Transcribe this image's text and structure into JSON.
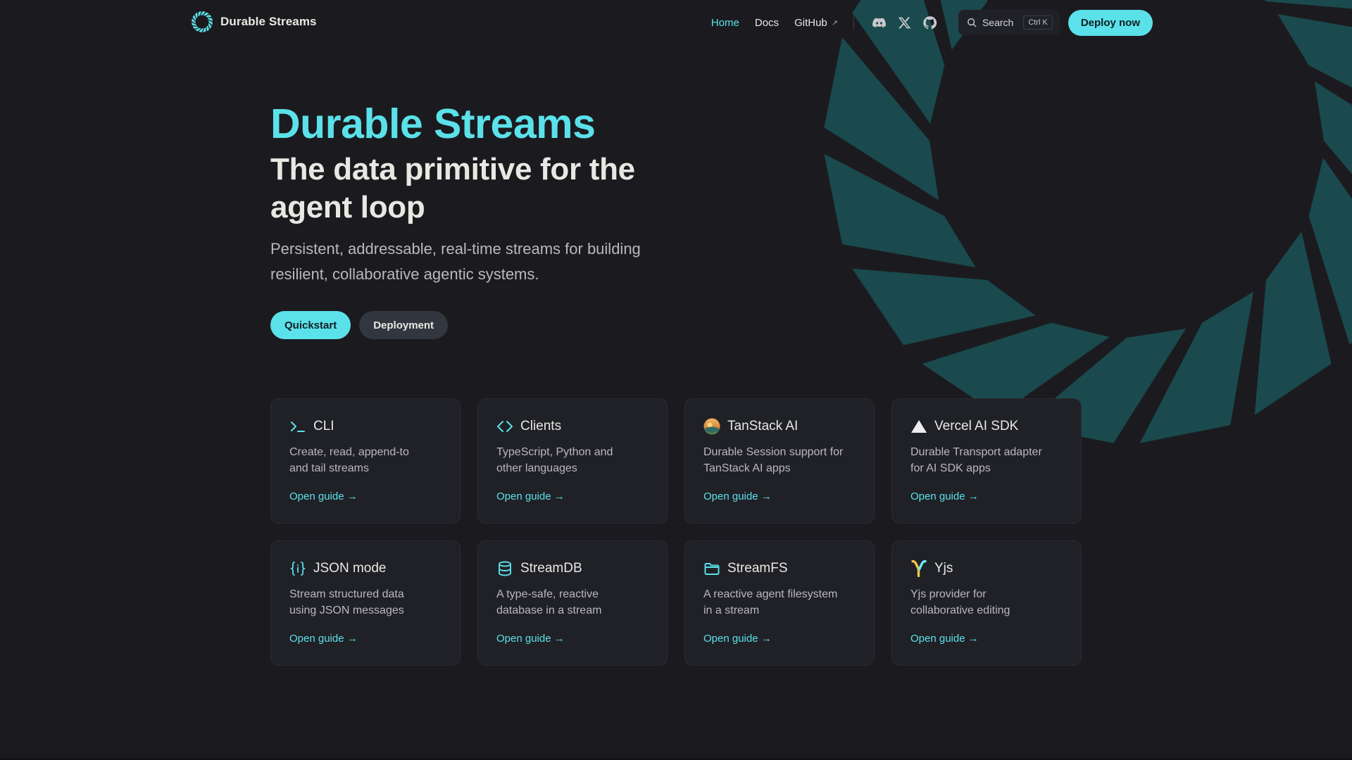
{
  "colors": {
    "accent": "#5be1ea",
    "background": "#1b1b1f",
    "card": "#202127",
    "logo_bg": "#1a4a4d"
  },
  "brand": {
    "name": "Durable Streams",
    "logo_icon": "durable-streams-logo"
  },
  "nav": {
    "links": [
      {
        "label": "Home",
        "active": true
      },
      {
        "label": "Docs",
        "active": false
      },
      {
        "label": "GitHub",
        "external": true
      }
    ],
    "external_arrow": "↗",
    "social": [
      "discord-icon",
      "x-icon",
      "github-icon"
    ],
    "search": {
      "label": "Search",
      "shortcut": "Ctrl K"
    },
    "deploy_label": "Deploy now"
  },
  "hero": {
    "title": "Durable Streams",
    "tagline": "The data primitive for the agent loop",
    "text": "Persistent, addressable, real-time streams for building resilient, collaborative agentic systems.",
    "primary_action": "Quickstart",
    "secondary_action": "Deployment"
  },
  "features": [
    {
      "title": "CLI",
      "desc": "Create, read, append-to and tail streams",
      "link": "Open guide →",
      "icon": "terminal-icon"
    },
    {
      "title": "Clients",
      "desc": "TypeScript, Python and other languages",
      "link": "Open guide →",
      "icon": "code-icon"
    },
    {
      "title": "TanStack AI",
      "desc": "Durable Session support for TanStack AI apps",
      "link": "Open guide →",
      "icon": "tanstack-icon"
    },
    {
      "title": "Vercel AI SDK",
      "desc": "Durable Transport adapter for AI SDK apps",
      "link": "Open guide →",
      "icon": "vercel-triangle-icon"
    },
    {
      "title": "JSON mode",
      "desc": "Stream structured data using JSON messages",
      "link": "Open guide →",
      "icon": "json-braces-icon"
    },
    {
      "title": "StreamDB",
      "desc": "A type-safe, reactive database in a stream",
      "link": "Open guide →",
      "icon": "database-icon"
    },
    {
      "title": "StreamFS",
      "desc": "A reactive agent filesystem in a stream",
      "link": "Open guide →",
      "icon": "folder-icon"
    },
    {
      "title": "Yjs",
      "desc": "Yjs provider for collaborative editing",
      "link": "Open guide →",
      "icon": "yjs-icon"
    }
  ]
}
